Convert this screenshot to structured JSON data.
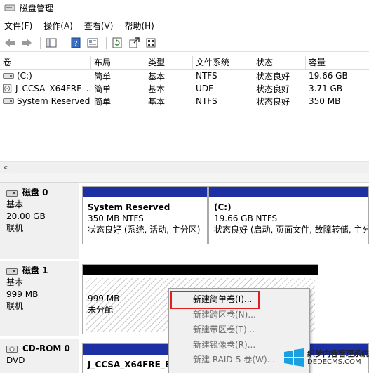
{
  "window": {
    "title": "磁盘管理"
  },
  "menu": [
    "文件(F)",
    "操作(A)",
    "查看(V)",
    "帮助(H)"
  ],
  "toolbar": [
    "back-icon",
    "forward-icon",
    "console-tree-icon",
    "help-icon",
    "properties-icon",
    "refresh-icon",
    "export-icon",
    "settings-icon"
  ],
  "volume_table": {
    "headers": [
      "卷",
      "布局",
      "类型",
      "文件系统",
      "状态",
      "容量"
    ],
    "rows": [
      {
        "volume": "(C:)",
        "layout": "简单",
        "type": "基本",
        "fs": "NTFS",
        "status": "状态良好",
        "capacity": "19.66 GB"
      },
      {
        "volume": "J_CCSA_X64FRE_...",
        "layout": "简单",
        "type": "基本",
        "fs": "UDF",
        "status": "状态良好",
        "capacity": "3.71 GB"
      },
      {
        "volume": "System Reserved",
        "layout": "简单",
        "type": "基本",
        "fs": "NTFS",
        "status": "状态良好",
        "capacity": "350 MB"
      }
    ]
  },
  "scroll_left": "<",
  "disks": [
    {
      "name": "磁盘 0",
      "type": "基本",
      "size": "20.00 GB",
      "state": "联机",
      "partitions": [
        {
          "title": "System Reserved",
          "size_fs": "350 MB NTFS",
          "status": "状态良好 (系统, 活动, 主分区)"
        },
        {
          "title": "(C:)",
          "size_fs": "19.66 GB NTFS",
          "status": "状态良好 (启动, 页面文件, 故障转储, 主分"
        }
      ]
    },
    {
      "name": "磁盘 1",
      "type": "基本",
      "size": "999 MB",
      "state": "联机",
      "partitions": [
        {
          "size": "999 MB",
          "status": "未分配"
        }
      ]
    },
    {
      "name": "CD-ROM 0",
      "type": "DVD",
      "partitions": [
        {
          "title": "J_CCSA_X64FRE_EN"
        }
      ]
    }
  ],
  "context_menu": [
    "新建简单卷(I)...",
    "新建跨区卷(N)...",
    "新建带区卷(T)...",
    "新建镜像卷(R)...",
    "新建 RAID-5 卷(W)..."
  ],
  "watermark": {
    "line1": "织梦内容管理系统",
    "line2": "DEDECMS.COM"
  },
  "colors": {
    "partition_bar_blue": "#1c2fa3",
    "unallocated_bar": "#000000",
    "highlight_border": "#e02020"
  }
}
